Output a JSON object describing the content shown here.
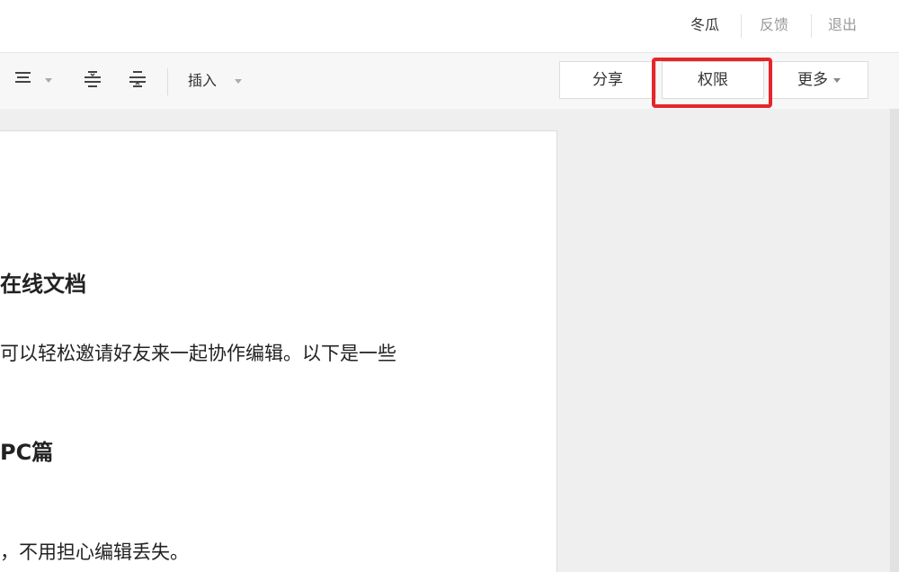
{
  "user_bar": {
    "username": "冬瓜",
    "feedback": "反馈",
    "logout": "退出"
  },
  "toolbar": {
    "align_icon": "align-icon",
    "indent_increase_icon": "indent-increase-icon",
    "indent_decrease_icon": "indent-decrease-icon",
    "insert_label": "插入",
    "share_label": "分享",
    "permission_label": "权限",
    "more_label": "更多"
  },
  "annotation": {
    "highlight_color": "#e8242b"
  },
  "document": {
    "heading1": "在线文档",
    "paragraph1": "可以轻松邀请好友来一起协作编辑。以下是一些",
    "heading2": "PC篇",
    "paragraph2": "，不用担心编辑丢失。"
  }
}
